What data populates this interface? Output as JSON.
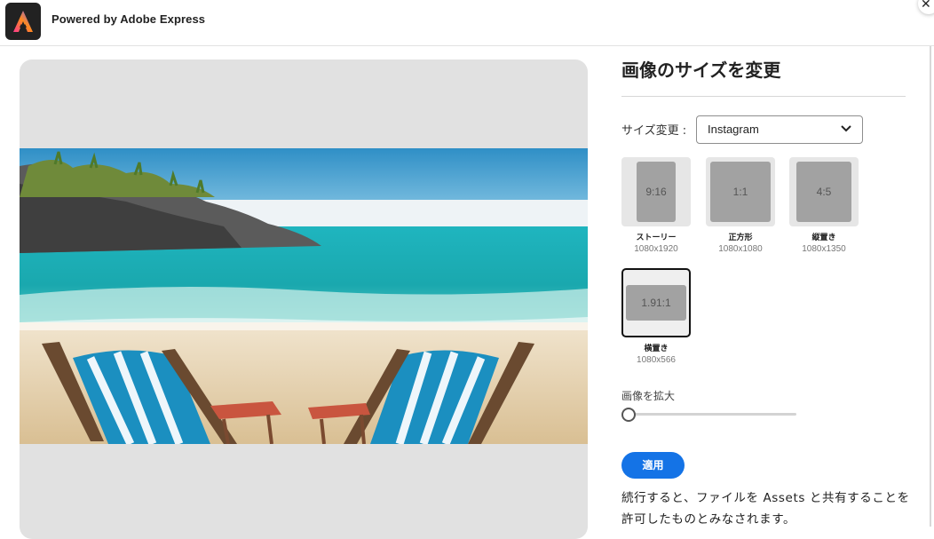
{
  "header": {
    "brand_text": "Powered by Adobe Express",
    "logo_icon": "adobe-express-logo"
  },
  "panel": {
    "title": "画像のサイズを変更",
    "size_label": "サイズ変更 :",
    "size_select": {
      "value": "Instagram"
    },
    "presets": [
      {
        "ratio": "9:16",
        "name": "ストーリー",
        "dims": "1080x1920",
        "selected": false
      },
      {
        "ratio": "1:1",
        "name": "正方形",
        "dims": "1080x1080",
        "selected": false
      },
      {
        "ratio": "4:5",
        "name": "縦置き",
        "dims": "1080x1350",
        "selected": false
      },
      {
        "ratio": "1.91:1",
        "name": "横置き",
        "dims": "1080x566",
        "selected": true
      }
    ],
    "zoom_label": "画像を拡大",
    "zoom_value": 0,
    "apply_label": "適用",
    "consent_text": "続行すると、ファイルを Assets と共有することを許可したものとみなされます。"
  },
  "colors": {
    "accent": "#1473e6",
    "preview_bg": "#e1e1e1"
  }
}
